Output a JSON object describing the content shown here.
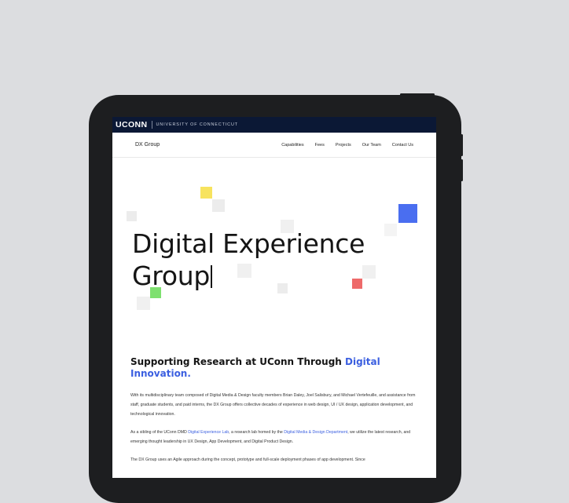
{
  "uconn_bar": {
    "logo": "UCONN",
    "subtitle": "UNIVERSITY OF CONNECTICUT"
  },
  "nav": {
    "brand": "DX Group",
    "links": [
      "Capabilities",
      "Fees",
      "Projects",
      "Our Team",
      "Contact Us"
    ]
  },
  "hero": {
    "title_line1": "Digital Experience",
    "title_line2": "Group"
  },
  "section": {
    "heading_prefix": "Supporting Research at UConn Through ",
    "heading_accent": "Digital Innovation.",
    "para1": "With its multidisciplinary team composed of Digital Media & Design faculty members Brian Daley, Joel Salisbury, and Michael Vertefeuille, and assistance from staff, graduate students, and paid interns, the DX Group offers collective decades of experience in web design, UI / UX design, application development, and technological innovation.",
    "para2_prefix": "As a sibling of the UConn DMD ",
    "para2_link1": "Digital Experience Lab",
    "para2_mid": ", a research lab homed by the ",
    "para2_link2": "Digital Media & Design Department",
    "para2_suffix": ", we utilize the latest research, and emerging thought leadership in UX Design, App Development, and Digital Product Design.",
    "para3": "The DX Group uses an Agile approach during the concept, prototype and full-scale deployment phases of app development. Since"
  },
  "colors": {
    "accent": "#3b5fe0",
    "navy": "#0b1835",
    "yellow": "#f7e35e",
    "green": "#7ee06f",
    "red": "#ee6a6a",
    "blue": "#4a6ef0"
  }
}
